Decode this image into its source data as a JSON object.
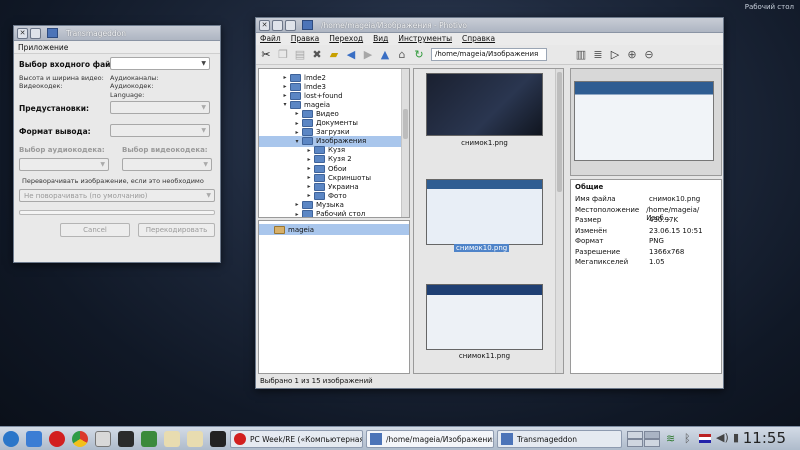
{
  "desktop": {
    "label": "Рабочий стол"
  },
  "transmageddon": {
    "title": "Transmageddon",
    "menu": "Приложение",
    "input_file_label": "Выбор входного файла:",
    "video_size_label": "Высота и ширина видео:",
    "video_codec_label": "Видеокодек:",
    "audio_channels_label": "Аудиоканалы:",
    "audio_codec_label": "Аудиокодек:",
    "language_label": "Language:",
    "presets_label": "Предустановки:",
    "output_format_label": "Формат вывода:",
    "audio_codec_select_label": "Выбор аудиокодека:",
    "video_codec_select_label": "Выбор видеокодека:",
    "rotate_hint": "Переворачивать изображение, если это необходимо",
    "rotate_value": "Не поворачивать (по умолчанию)",
    "cancel_label": "Cancel",
    "transcode_label": "Перекодировать"
  },
  "photivo": {
    "title": "/home/mageia/Изображения - Photivo",
    "menu": [
      "Файл",
      "Правка",
      "Переход",
      "Вид",
      "Инструменты",
      "Справка"
    ],
    "path": "/home/mageia/Изображения",
    "tree": [
      {
        "label": "lmde2",
        "indent": 0,
        "open": false,
        "selected": false
      },
      {
        "label": "lmde3",
        "indent": 0,
        "open": false,
        "selected": false
      },
      {
        "label": "lost+found",
        "indent": 0,
        "open": false,
        "selected": false
      },
      {
        "label": "mageia",
        "indent": 0,
        "open": true,
        "selected": false
      },
      {
        "label": "Видео",
        "indent": 1,
        "open": false,
        "selected": false
      },
      {
        "label": "Документы",
        "indent": 1,
        "open": false,
        "selected": false
      },
      {
        "label": "Загрузки",
        "indent": 1,
        "open": false,
        "selected": false
      },
      {
        "label": "Изображения",
        "indent": 1,
        "open": true,
        "selected": true
      },
      {
        "label": "Кузя",
        "indent": 2,
        "open": false,
        "selected": false
      },
      {
        "label": "Кузя 2",
        "indent": 2,
        "open": false,
        "selected": false
      },
      {
        "label": "Обои",
        "indent": 2,
        "open": false,
        "selected": false
      },
      {
        "label": "Скриншоты",
        "indent": 2,
        "open": false,
        "selected": false
      },
      {
        "label": "Украина",
        "indent": 2,
        "open": false,
        "selected": false
      },
      {
        "label": "Фото",
        "indent": 2,
        "open": false,
        "selected": false
      },
      {
        "label": "Музыка",
        "indent": 1,
        "open": false,
        "selected": false
      },
      {
        "label": "Рабочий стол",
        "indent": 1,
        "open": false,
        "selected": false
      }
    ],
    "bookmark": "mageia",
    "thumbs": [
      {
        "name": "снимок1.png",
        "selected": false
      },
      {
        "name": "снимок10.png",
        "selected": true
      },
      {
        "name": "снимок11.png",
        "selected": false
      }
    ],
    "info": {
      "title": "Общие",
      "rows": [
        {
          "key": "Имя файла",
          "value": "снимок10.png"
        },
        {
          "key": "Местоположение",
          "value": "/home/mageia/Изоб…"
        },
        {
          "key": "Размер",
          "value": "430.97K"
        },
        {
          "key": "Изменён",
          "value": "23.06.15 10:51"
        },
        {
          "key": "Формат",
          "value": "PNG"
        },
        {
          "key": "Разрешение",
          "value": "1366x768"
        },
        {
          "key": "Мегапикселей",
          "value": "1.05"
        }
      ]
    },
    "status": "Выбрано 1 из 15 изображений"
  },
  "taskbar": {
    "tasks": [
      {
        "label": "PC Week/RE («Компьютерная н…",
        "active": false
      },
      {
        "label": "/home/mageia/Изображения - Ph…",
        "active": true
      },
      {
        "label": "Transmageddon",
        "active": false
      }
    ],
    "clock": "11:55"
  },
  "colors": {
    "selection": "#a9c6ec",
    "accent": "#4f84c9"
  }
}
